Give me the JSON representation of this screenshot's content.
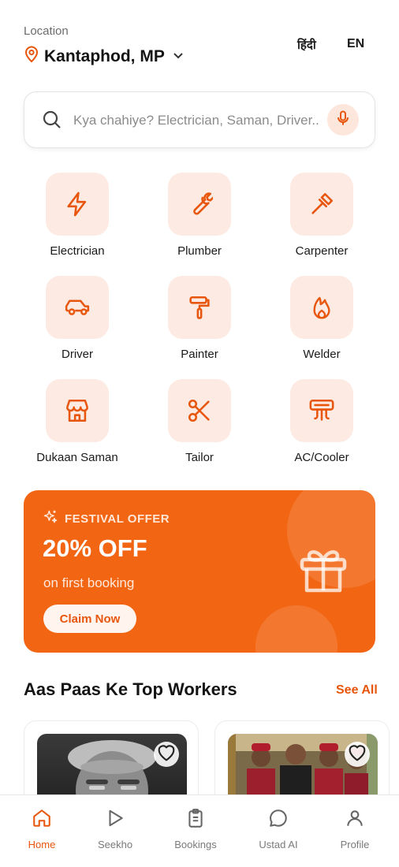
{
  "header": {
    "location_label": "Location",
    "location_value": "Kantaphod, MP",
    "lang_hi": "हिंदी",
    "lang_en": "EN"
  },
  "search": {
    "placeholder": "Kya chahiye? Electrician, Saman, Driver..."
  },
  "categories": [
    {
      "label": "Electrician",
      "icon": "bolt-icon"
    },
    {
      "label": "Plumber",
      "icon": "wrench-icon"
    },
    {
      "label": "Carpenter",
      "icon": "hammer-icon"
    },
    {
      "label": "Driver",
      "icon": "car-icon"
    },
    {
      "label": "Painter",
      "icon": "paint-roller-icon"
    },
    {
      "label": "Welder",
      "icon": "flame-icon"
    },
    {
      "label": "Dukaan Saman",
      "icon": "store-icon"
    },
    {
      "label": "Tailor",
      "icon": "scissors-icon"
    },
    {
      "label": "AC/Cooler",
      "icon": "air-conditioner-icon"
    }
  ],
  "offer": {
    "tag": "FESTIVAL OFFER",
    "headline": "20% OFF",
    "subtext": "on first booking",
    "cta": "Claim Now"
  },
  "workers_section": {
    "title": "Aas Paas Ke Top Workers",
    "see_all": "See All"
  },
  "nav": [
    {
      "label": "Home",
      "icon": "home-icon",
      "active": true
    },
    {
      "label": "Seekho",
      "icon": "play-icon",
      "active": false
    },
    {
      "label": "Bookings",
      "icon": "clipboard-icon",
      "active": false
    },
    {
      "label": "Ustad AI",
      "icon": "chat-bubble-icon",
      "active": false
    },
    {
      "label": "Profile",
      "icon": "user-icon",
      "active": false
    }
  ],
  "colors": {
    "accent": "#f26513",
    "tile_bg": "#fdeae2",
    "text": "#1a1a1a"
  }
}
